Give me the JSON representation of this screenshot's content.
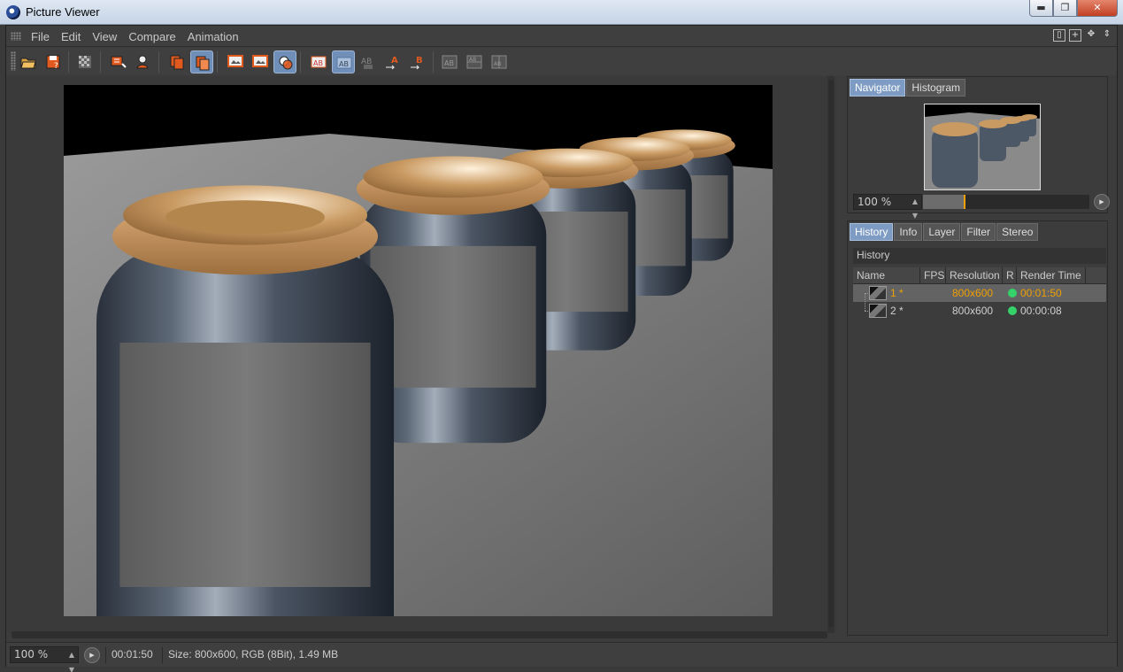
{
  "window": {
    "title": "Picture Viewer",
    "min_glyph": "▬",
    "max_glyph": "❐",
    "close_glyph": "✕"
  },
  "menu": {
    "items": [
      "File",
      "Edit",
      "View",
      "Compare",
      "Animation"
    ]
  },
  "right_panel": {
    "navigator_tabs": [
      "Navigator",
      "Histogram"
    ],
    "navigator_zoom": "100 %",
    "navigator_zoom_level": 0.25,
    "history_tabs": [
      "History",
      "Info",
      "Layer",
      "Filter",
      "Stereo"
    ],
    "history_title": "History",
    "columns": [
      "Name",
      "FPS",
      "Resolution",
      "R",
      "Render Time"
    ],
    "rows": [
      {
        "name": "1 *",
        "fps": "",
        "resolution": "800x600",
        "status": "green",
        "render_time": "00:01:50",
        "selected": true
      },
      {
        "name": "2 *",
        "fps": "",
        "resolution": "800x600",
        "status": "green",
        "render_time": "00:00:08",
        "selected": false
      }
    ]
  },
  "status": {
    "zoom": "100 %",
    "time": "00:01:50",
    "info": "Size: 800x600, RGB (8Bit), 1.49 MB"
  },
  "colors": {
    "accent": "#f0a000",
    "tab_active": "#7e9cc3",
    "status_ok": "#35d16a"
  }
}
